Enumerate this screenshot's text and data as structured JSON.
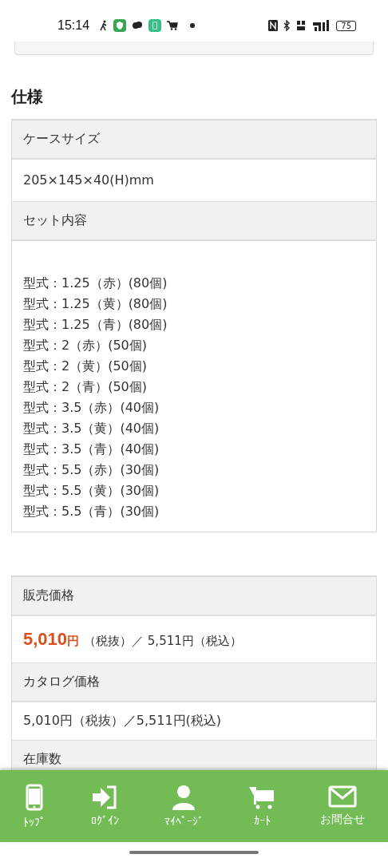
{
  "status_bar": {
    "time": "15:14",
    "battery": "75"
  },
  "spec": {
    "title": "仕様",
    "rows": [
      {
        "label": "ケースサイズ",
        "lines": [
          "205×145×40(H)mm"
        ]
      },
      {
        "label": "セット内容",
        "lines": [
          "型式：1.25（赤）(80個)",
          "型式：1.25（黄）(80個)",
          "型式：1.25（青）(80個)",
          "型式：2（赤）(50個)",
          "型式：2（黄）(50個)",
          "型式：2（青）(50個)",
          "型式：3.5（赤）(40個)",
          "型式：3.5（黄）(40個)",
          "型式：3.5（青）(40個)",
          "型式：5.5（赤）(30個)",
          "型式：5.5（黄）(30個)",
          "型式：5.5（青）(30個)"
        ]
      }
    ]
  },
  "price": {
    "label": "販売価格",
    "amount": "5,010",
    "unit": "円",
    "rest": "（税抜）／ 5,511円（税込）"
  },
  "catalog": {
    "label": "カタログ価格",
    "value": "5,010円（税抜）／5,511円(税込)"
  },
  "stock": {
    "label": "在庫数"
  },
  "nav": [
    {
      "kind": "phone",
      "label": "ﾄｯﾌﾟ"
    },
    {
      "kind": "login",
      "label": "ﾛｸﾞｲﾝ"
    },
    {
      "kind": "person",
      "label": "ﾏｲﾍﾟｰｼﾞ"
    },
    {
      "kind": "cart",
      "label": "ｶｰﾄ"
    },
    {
      "kind": "mail",
      "label": "お問合せ"
    }
  ]
}
